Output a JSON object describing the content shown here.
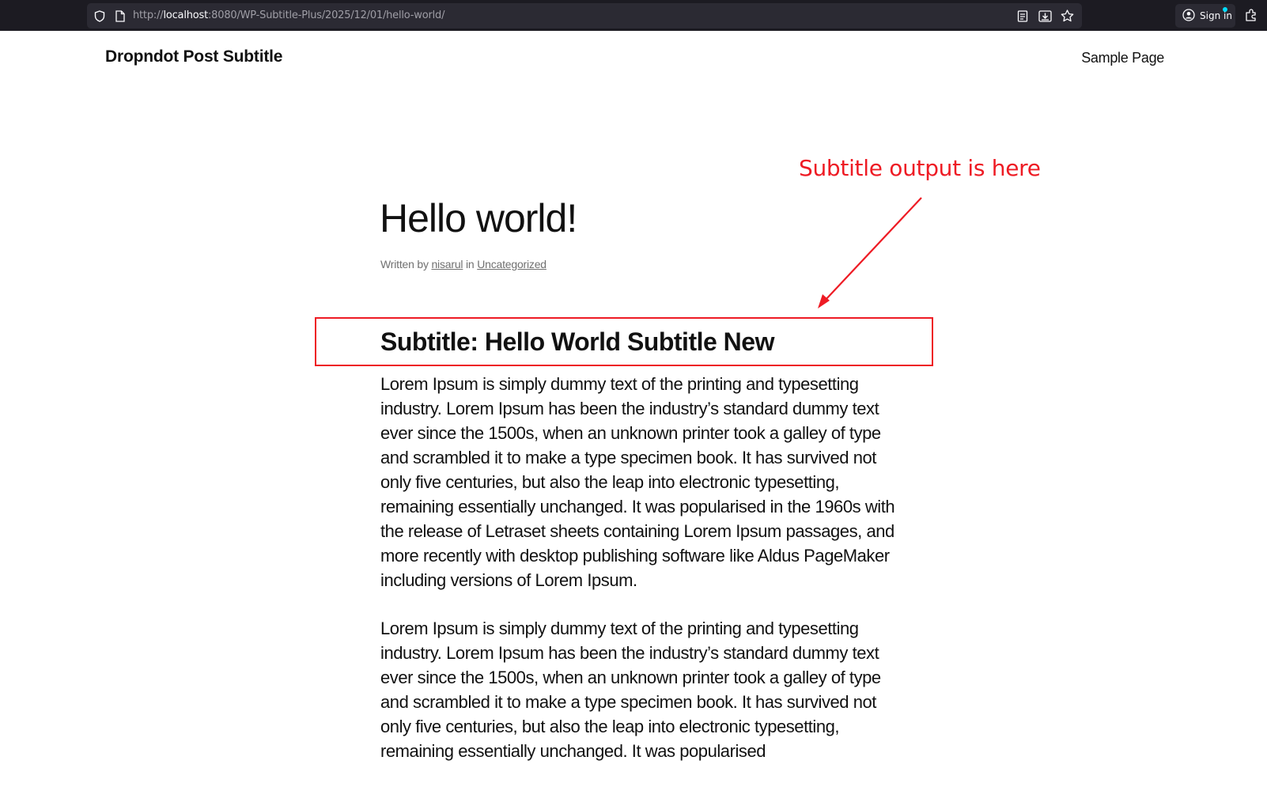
{
  "browser": {
    "url_prefix": "http://",
    "url_host": "localhost",
    "url_rest": ":8080/WP-Subtitle-Plus/2025/12/01/hello-world/",
    "signin_label": "Sign in",
    "icons": [
      "shield-icon",
      "page-icon",
      "reader-view-icon",
      "save-to-pocket-icon",
      "bookmark-star-icon",
      "account-icon",
      "extensions-icon"
    ]
  },
  "site": {
    "title": "Dropndot Post Subtitle",
    "nav": [
      "Sample Page"
    ]
  },
  "post": {
    "title": "Hello world!",
    "meta_written_by": "Written by",
    "author": "nisarul",
    "meta_in": "in",
    "category": "Uncategorized",
    "subtitle": "Subtitle: Hello World Subtitle New",
    "paragraphs": [
      "Lorem Ipsum is simply dummy text of the printing and typesetting industry. Lorem Ipsum has been the industry’s standard dummy text ever since the 1500s, when an unknown printer took a galley of type and scrambled it to make a type specimen book. It has survived not only five centuries, but also the leap into electronic typesetting, remaining essentially unchanged. It was popularised in the 1960s with the release of Letraset sheets containing Lorem Ipsum passages, and more recently with desktop publishing software like Aldus PageMaker including versions of Lorem Ipsum.",
      "Lorem Ipsum is simply dummy text of the printing and typesetting industry. Lorem Ipsum has been the industry’s standard dummy text ever since the 1500s, when an unknown printer took a galley of type and scrambled it to make a type specimen book. It has survived not only five centuries, but also the leap into electronic typesetting, remaining essentially unchanged. It was popularised"
    ]
  },
  "annotation": {
    "text": "Subtitle output is here",
    "color": "#ee1b24"
  }
}
